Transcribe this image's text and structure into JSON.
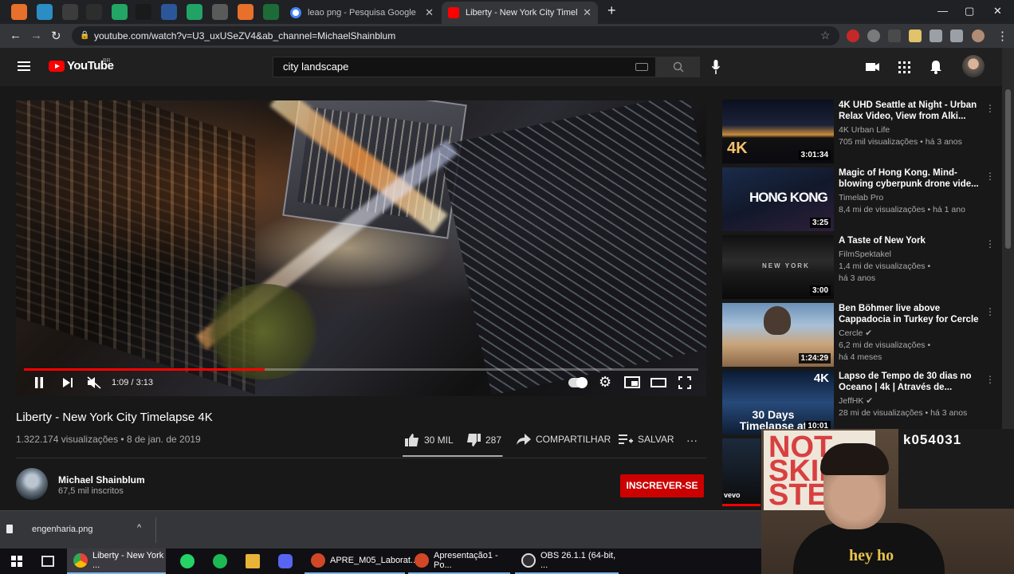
{
  "browser": {
    "tabs": [
      {
        "title": "leao png - Pesquisa Google",
        "active": false
      },
      {
        "title": "Liberty - New York City Timelapse",
        "active": true
      }
    ],
    "new_tab": "+",
    "window_controls": {
      "minimize": "—",
      "maximize": "▢",
      "close": "✕"
    },
    "url": "youtube.com/watch?v=U3_uxUSeZV4&ab_channel=MichaelShainblum"
  },
  "youtube": {
    "logo_text": "YouTube",
    "logo_region": "BR",
    "search_value": "city landscape",
    "colors": {
      "brand_red": "#ff0000",
      "subscribe_red": "#cc0000",
      "background": "#181818"
    }
  },
  "player": {
    "time_current": "1:09",
    "time_total": "3:13",
    "progress": 0.357
  },
  "video": {
    "title": "Liberty - New York City Timelapse 4K",
    "views": "1.322.174 visualizações",
    "date": "8 de jan. de 2019",
    "likes": "30 MIL",
    "dislikes": "287",
    "like_ratio": 0.99,
    "share_label": "COMPARTILHAR",
    "save_label": "SALVAR",
    "more_label": "···"
  },
  "channel": {
    "name": "Michael Shainblum",
    "subscribers": "67,5 mil inscritos",
    "subscribe_label": "INSCREVER-SE"
  },
  "recommendations": [
    {
      "title": "4K UHD Seattle at Night - Urban Relax Video, View from Alki...",
      "channel": "4K Urban Life",
      "views": "705 mil visualizações",
      "age": "há 3 anos",
      "duration": "3:01:34",
      "thumb_text": "4K"
    },
    {
      "title": "Magic of Hong Kong. Mind-blowing cyberpunk drone vide...",
      "channel": "Timelab Pro",
      "views": "8,4 mi de visualizações",
      "age": "há 1 ano",
      "duration": "3:25",
      "thumb_text": "HONG KONG"
    },
    {
      "title": "A Taste of New York",
      "channel": "FilmSpektakel",
      "views": "1,4 mi de visualizações",
      "age": "há 3 anos",
      "duration": "3:00",
      "thumb_text": "NEW YORK"
    },
    {
      "title": "Ben Böhmer live above Cappadocia in Turkey for Cercle",
      "channel": "Cercle",
      "views": "6,2 mi de visualizações",
      "age": "há 4 meses",
      "duration": "1:24:29",
      "thumb_text": ""
    },
    {
      "title": "Lapso de Tempo de 30 dias no Oceano | 4k | Através de...",
      "channel": "JeffHK",
      "views": "28 mi de visualizações",
      "age": "há 3 anos",
      "duration": "10:01",
      "thumb_text": "30 Days Timelapse at",
      "thumb_badge": "4K"
    }
  ],
  "webcam": {
    "poster_left": [
      "NOT",
      "SKIP",
      "STEPS"
    ],
    "poster_right": "k054031",
    "shirt_text": "hey ho"
  },
  "downloads": {
    "file": "engenharia.png",
    "chevron": "^"
  },
  "taskbar": {
    "items": [
      {
        "label": "Liberty - New York ...",
        "color": "#4285f4",
        "active": true
      },
      {
        "label": "",
        "color": "#25d366"
      },
      {
        "label": "",
        "color": "#1db954"
      },
      {
        "label": "",
        "color": "#e8b339"
      },
      {
        "label": "",
        "color": "#5865f2"
      },
      {
        "label": "APRE_M05_Laborat...",
        "color": "#d24726"
      },
      {
        "label": "Apresentação1 - Po...",
        "color": "#d24726"
      },
      {
        "label": "OBS 26.1.1 (64-bit, ...",
        "color": "#302e31"
      }
    ]
  }
}
